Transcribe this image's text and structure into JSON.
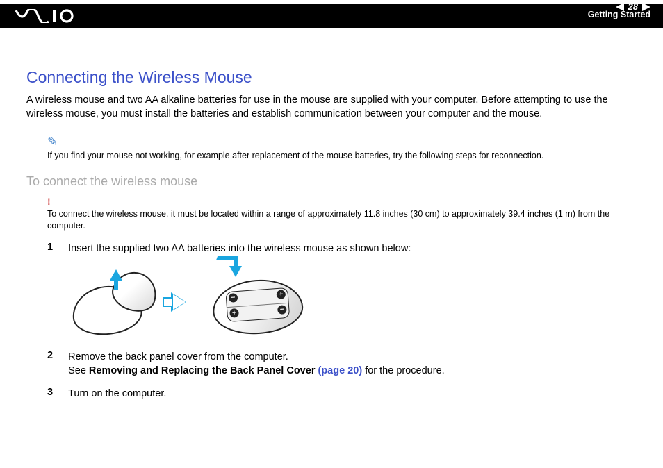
{
  "header": {
    "page_number": "28",
    "section": "Getting Started"
  },
  "title": "Connecting the Wireless Mouse",
  "intro": "A wireless mouse and two AA alkaline batteries for use in the mouse are supplied with your computer. Before attempting to use the wireless mouse, you must install the batteries and establish communication between your computer and the mouse.",
  "note": "If you find your mouse not working, for example after replacement of the mouse batteries, try the following steps for reconnection.",
  "subhead": "To connect the wireless mouse",
  "warning_mark": "!",
  "warning": "To connect the wireless mouse, it must be located within a range of approximately 11.8 inches (30 cm) to approximately 39.4 inches (1 m) from the computer.",
  "steps": {
    "s1": {
      "num": "1",
      "text": "Insert the supplied two AA batteries into the wireless mouse as shown below:"
    },
    "s2": {
      "num": "2",
      "line1": "Remove the back panel cover from the computer.",
      "line2a": "See ",
      "bold": "Removing and Replacing the Back Panel Cover ",
      "link": "(page 20)",
      "line2b": " for the procedure."
    },
    "s3": {
      "num": "3",
      "text": "Turn on the computer."
    }
  },
  "battery": {
    "minus": "−",
    "plus": "+"
  }
}
